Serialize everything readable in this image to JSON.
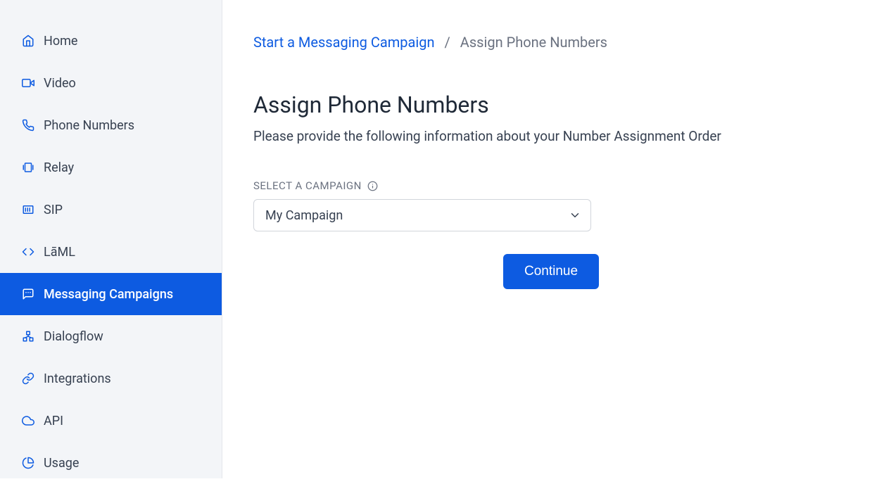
{
  "sidebar": {
    "items": [
      {
        "label": "Home"
      },
      {
        "label": "Video"
      },
      {
        "label": "Phone Numbers"
      },
      {
        "label": "Relay"
      },
      {
        "label": "SIP"
      },
      {
        "label": "LāML"
      },
      {
        "label": "Messaging Campaigns"
      },
      {
        "label": "Dialogflow"
      },
      {
        "label": "Integrations"
      },
      {
        "label": "API"
      },
      {
        "label": "Usage"
      }
    ]
  },
  "breadcrumb": {
    "link": "Start a Messaging Campaign",
    "current": "Assign Phone Numbers",
    "separator": "/"
  },
  "page": {
    "title": "Assign Phone Numbers",
    "subtitle": "Please provide the following information about your Number Assignment Order"
  },
  "form": {
    "select_label": "SELECT A CAMPAIGN",
    "select_value": "My Campaign",
    "continue_label": "Continue"
  }
}
